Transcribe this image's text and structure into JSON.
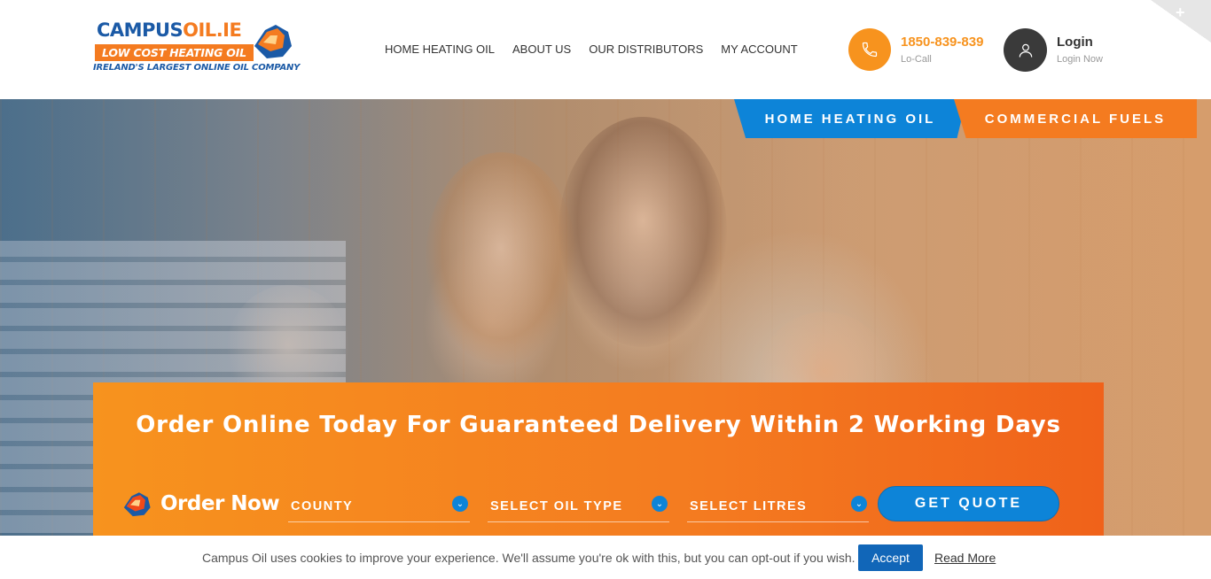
{
  "brand": {
    "name_main": "CAMPUS",
    "name_accent": "OIL.IE",
    "tagline": "LOW COST HEATING OIL",
    "subtitle": "IRELAND'S LARGEST ONLINE OIL COMPANY"
  },
  "nav": {
    "items": [
      {
        "label": "HOME HEATING OIL"
      },
      {
        "label": "ABOUT US"
      },
      {
        "label": "OUR DISTRIBUTORS"
      },
      {
        "label": "MY ACCOUNT"
      }
    ]
  },
  "contact": {
    "phone": "1850-839-839",
    "phone_sub": "Lo-Call",
    "icon": "phone-icon"
  },
  "account": {
    "title": "Login",
    "subtitle": "Login Now",
    "icon": "user-icon"
  },
  "corner": {
    "symbol": "+"
  },
  "hero": {
    "tabs": [
      {
        "label": "HOME HEATING OIL",
        "color": "#0d84d8"
      },
      {
        "label": "COMMERCIAL FUELS",
        "color": "#f47b20"
      }
    ]
  },
  "order": {
    "heading": "Order Online Today For Guaranteed Delivery Within 2 Working Days",
    "order_now": "Order Now",
    "selects": {
      "county": "COUNTY",
      "oil_type": "SELECT OIL TYPE",
      "litres": "SELECT LITRES"
    },
    "quote_button": "GET QUOTE"
  },
  "cookie": {
    "text": "Campus Oil uses cookies to improve your experience. We'll assume you're ok with this, but you can opt-out if you wish.",
    "accept": "Accept",
    "read_more": "Read More"
  },
  "colors": {
    "brand_blue": "#1b5aa6",
    "brand_orange": "#f47b20",
    "button_blue": "#0d84d8"
  }
}
